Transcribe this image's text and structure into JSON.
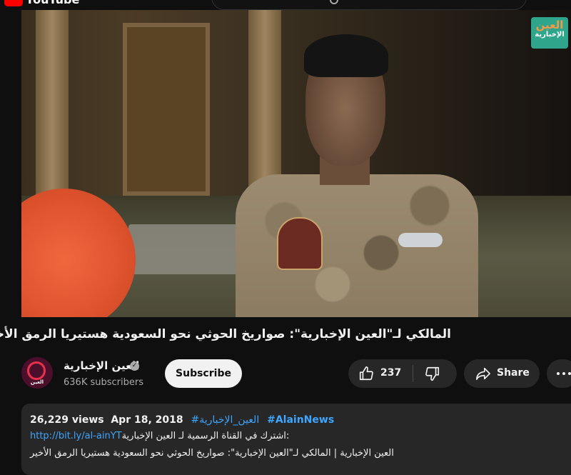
{
  "masthead": {
    "logo_text": "YouTube"
  },
  "video": {
    "overlay_logo_line1": "العين",
    "overlay_logo_line2": "الإخبارية"
  },
  "title": "المالكي لـ\"العين الإخبارية\": صواريخ الحوثي نحو السعودية هستيريا الرمق الأخير",
  "owner": {
    "channel_name": "العين الإخبارية",
    "avatar_text": "العين",
    "subscribers": "636K subscribers",
    "subscribe_label": "Subscribe"
  },
  "actions": {
    "like_count": "237",
    "share_label": "Share"
  },
  "description": {
    "views": "26,229 views",
    "date": "Apr 18, 2018",
    "hashtag_ar": "#العين_الإخبارية",
    "hashtag_en": "#AlainNews",
    "line2_text": "اشترك في القناة الرسمية لـ العين الإخبارية:",
    "line2_link": "http://bit.ly/al-ainYT",
    "line3_text": "العين الإخبارية | المالكي لـ\"العين الإخبارية\": صواريخ الحوثي نحو السعودية هستيريا الرمق الأخير"
  },
  "colors": {
    "background": "#0f0f0f",
    "button_bg": "#272727",
    "link": "#3ea6ff",
    "subscribe_bg": "#f1f1f1",
    "brand_red": "#ff0000"
  }
}
